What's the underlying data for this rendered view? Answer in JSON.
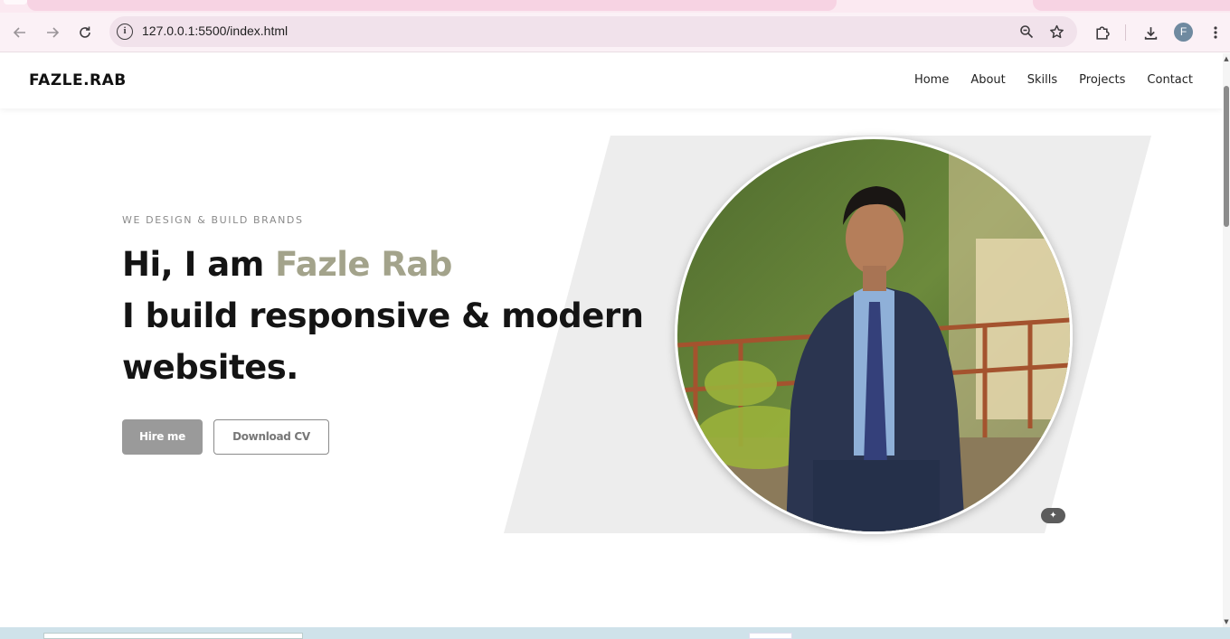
{
  "browser": {
    "url": "127.0.0.1:5500/index.html",
    "profile_initial": "F",
    "icons": {
      "back": "arrow-left-icon",
      "forward": "arrow-right-icon",
      "reload": "reload-icon",
      "info": "site-info-icon",
      "zoom": "zoom-icon",
      "bookmark": "star-icon",
      "extensions": "puzzle-icon",
      "downloads": "download-icon",
      "menu": "kebab-menu-icon"
    }
  },
  "site": {
    "logo": "FAZLE.RAB",
    "nav": [
      "Home",
      "About",
      "Skills",
      "Projects",
      "Contact"
    ]
  },
  "hero": {
    "tagline": "WE DESIGN & BUILD BRANDS",
    "greeting": "Hi, I am ",
    "name": "Fazle Rab",
    "line2": "I build responsive & modern",
    "line3": "websites.",
    "hire_label": "Hire me",
    "cv_label": "Download CV"
  },
  "colors": {
    "accent": "#a3a38b",
    "hire_button": "#9a9a9a",
    "hero_shape": "#ededed"
  }
}
